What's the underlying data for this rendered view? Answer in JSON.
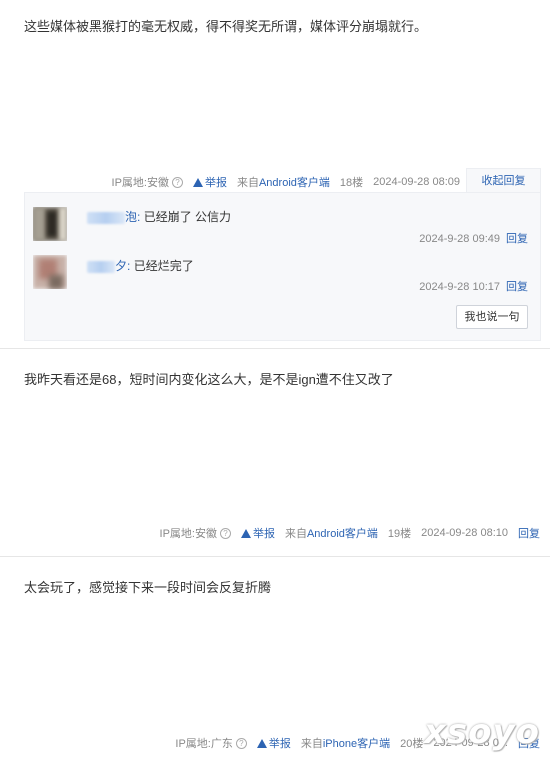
{
  "posts": [
    {
      "content": "这些媒体被黑猴打的毫无权威，得不得奖无所谓，媒体评分崩塌就行。",
      "ip": "IP属地:安徽",
      "report": "举报",
      "client_prefix": "来自",
      "client": "Android客户端",
      "floor": "18楼",
      "time": "2024-09-28 08:09",
      "action": "收起回复"
    },
    {
      "content": "我昨天看还是68，短时间内变化这么大，是不是ign遭不住又改了",
      "ip": "IP属地:安徽",
      "report": "举报",
      "client_prefix": "来自",
      "client": "Android客户端",
      "floor": "19楼",
      "time": "2024-09-28 08:10",
      "action": "回复"
    },
    {
      "content": "太会玩了，感觉接下来一段时间会反复折腾",
      "ip": "IP属地:广东",
      "report": "举报",
      "client_prefix": "来自",
      "client": "iPhone客户端",
      "floor": "20楼",
      "time": "2024-09-28 08:",
      "action": "回复"
    }
  ],
  "subreplies": [
    {
      "user_tail": "泡:",
      "text": "已经崩了 公信力",
      "time": "2024-9-28 09:49",
      "reply": "回复"
    },
    {
      "user_tail": "夕:",
      "text": "已经烂完了",
      "time": "2024-9-28 10:17",
      "reply": "回复"
    }
  ],
  "say_button": "我也说一句",
  "watermark": "xsoyo",
  "colors": {
    "link": "#2d64b3",
    "meta": "#888888",
    "subbox_bg": "#f7f8fa"
  }
}
